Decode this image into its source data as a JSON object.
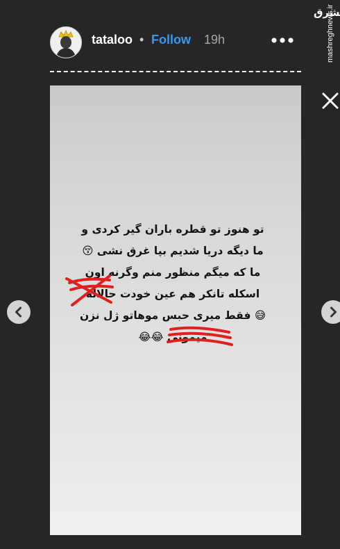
{
  "header": {
    "username": "tataloo",
    "separator": "•",
    "follow_label": "Follow",
    "time": "19h"
  },
  "watermark": {
    "logo": "مشرق",
    "url": "mashreghnews.ir"
  },
  "story": {
    "lines": [
      "تو هنوز تو قطره باران گیر کردی و",
      "ما دیگه دریا شدیم بپا غرق نشی 😚",
      "ما که میگم منظور منم وگرنه اون",
      "اسکله تانکر هم عین خودت حالاله",
      "😅 فقط میری حبس موهاتو ژل نزن",
      "میمونی 😂😂"
    ]
  },
  "icons": {
    "more": "more-horizontal-icon",
    "close": "close-icon",
    "prev": "chevron-left-icon",
    "next": "chevron-right-icon"
  },
  "colors": {
    "background": "#262626",
    "follow": "#3897f0",
    "scribble": "#e02020"
  }
}
